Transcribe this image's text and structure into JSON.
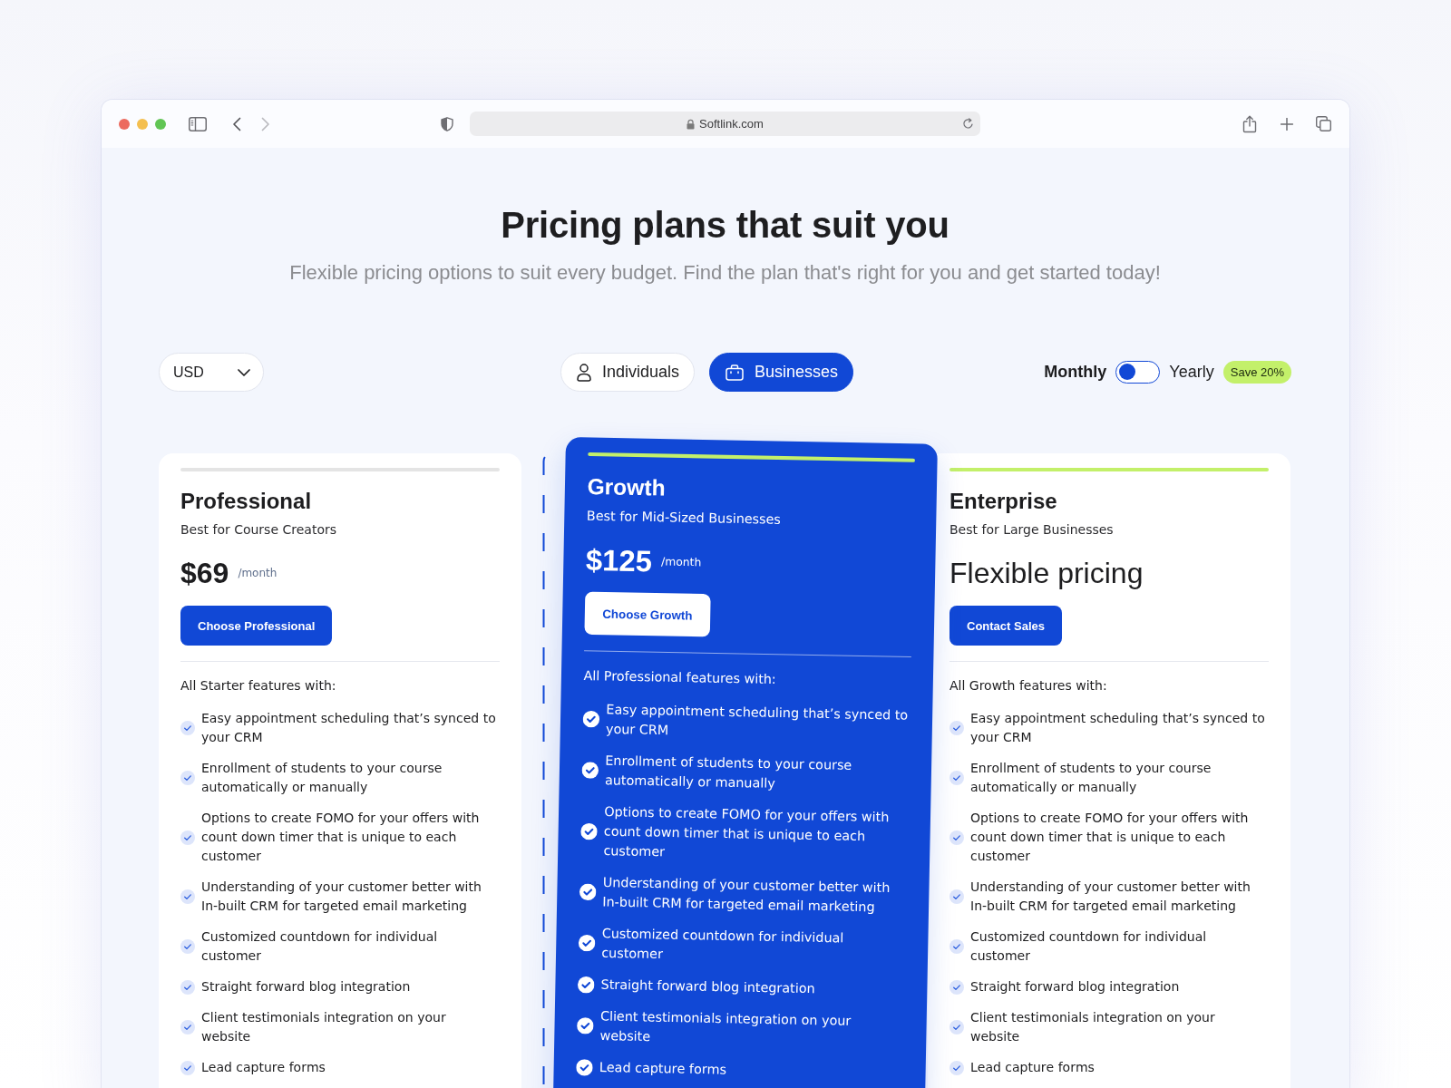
{
  "browser": {
    "url": "Softlink.com",
    "back_disabled": false,
    "forward_disabled": true
  },
  "header": {
    "title": "Pricing plans that suit you",
    "subtitle": "Flexible pricing options to suit every budget. Find the plan that's right for you and get started today!"
  },
  "controls": {
    "currency": "USD",
    "audience_tabs": [
      {
        "label": "Individuals",
        "kind": "person",
        "selected": false
      },
      {
        "label": "Businesses",
        "kind": "briefcase",
        "selected": true
      }
    ],
    "billing": {
      "monthly_label": "Monthly",
      "yearly_label": "Yearly",
      "yearly": false,
      "badge": "Save 20%"
    }
  },
  "plans": [
    {
      "name": "Professional",
      "subtitle": "Best for Course Creators",
      "color": "#e4e4e4",
      "featured": false,
      "price": {
        "kind": "amount",
        "value": "$69",
        "period": "/month"
      },
      "button": "Choose Professional",
      "features_heading": "All Starter features with:",
      "features": [
        "Easy appointment scheduling that’s synced to your CRM",
        "Enrollment of students to your course automatically or manually",
        "Options to create FOMO for your offers with count down timer that is unique to each customer",
        "Understanding of your customer better with In-built CRM for targeted email marketing",
        "Customized countdown for individual customer",
        "Straight forward blog integration",
        "Client testimonials integration on your website",
        "Lead capture forms"
      ]
    },
    {
      "name": "Growth",
      "subtitle": "Best for Mid-Sized Businesses",
      "color": "#c3f06a",
      "featured": true,
      "price": {
        "kind": "amount",
        "value": "$125",
        "period": "/month"
      },
      "button": "Choose Growth",
      "features_heading": "All Professional features with:",
      "features": [
        "Easy appointment scheduling that’s synced to your CRM",
        "Enrollment of students to your course automatically or manually",
        "Options to create FOMO for your offers with count down timer that is unique to each customer",
        "Understanding of your customer better with In-built CRM for targeted email marketing",
        "Customized countdown for individual customer",
        "Straight forward blog integration",
        "Client testimonials integration on your website",
        "Lead capture forms"
      ]
    },
    {
      "name": "Enterprise",
      "subtitle": "Best for Large Businesses",
      "color": "#c3f06a",
      "featured": false,
      "price": {
        "kind": "text",
        "value": "Flexible pricing"
      },
      "button": "Contact Sales",
      "features_heading": "All Growth features with:",
      "features": [
        "Easy appointment scheduling that’s synced to your CRM",
        "Enrollment of students to your course automatically or manually",
        "Options to create FOMO for your offers with count down timer that is unique to each customer",
        "Understanding of your customer better with In-built CRM for targeted email marketing",
        "Customized countdown for individual customer",
        "Straight forward blog integration",
        "Client testimonials integration on your website",
        "Lead capture forms"
      ]
    }
  ]
}
